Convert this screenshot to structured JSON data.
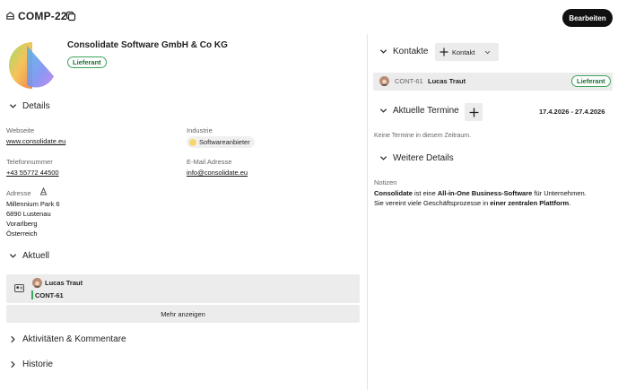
{
  "header": {
    "id": "COMP-22",
    "edit_label": "Bearbeiten"
  },
  "company": {
    "name": "Consolidate Software GmbH & Co KG",
    "badge": "Lieferant"
  },
  "details": {
    "title": "Details",
    "website_label": "Webseite",
    "website_value": "www.consolidate.eu",
    "industry_label": "Industrie",
    "industry_value": "Softwareanbieter",
    "phone_label": "Telefonnummer",
    "phone_value": "+43 55772 44500",
    "email_label": "E-Mail Adresse",
    "email_value": "info@consolidate.eu",
    "address_label": "Adresse",
    "address_lines": [
      "Millennium Park 6",
      "6890 Lustenau",
      "Vorarlberg",
      "Österreich"
    ]
  },
  "aktuell": {
    "title": "Aktuell",
    "person": "Lucas Traut",
    "contact_id": "CONT-61",
    "more_label": "Mehr anzeigen"
  },
  "activities_title": "Aktivitäten & Kommentare",
  "history_title": "Historie",
  "kontakte": {
    "title": "Kontakte",
    "add_label": "Kontakt",
    "row": {
      "id": "CONT-61",
      "name": "Lucas Traut",
      "badge": "Lieferant"
    }
  },
  "termine": {
    "title": "Aktuelle Termine",
    "range": "17.4.2026 - 27.4.2026",
    "empty": "Keine Termine in diesem Zeitraum."
  },
  "weitere": {
    "title": "Weitere Details",
    "notes_label": "Notizen",
    "line1": {
      "b1": "Consolidate",
      "t1": " ist eine ",
      "b2": "All-in-One Business-Software",
      "t2": " für Unternehmen."
    },
    "line2": {
      "t1": "Sie vereint viele Geschäftsprozesse in ",
      "b1": "einer zentralen Plattform",
      "t2": "."
    }
  },
  "colors": {
    "accent_green": "#3ba55c",
    "dark": "#111111",
    "surface": "#ececec"
  }
}
